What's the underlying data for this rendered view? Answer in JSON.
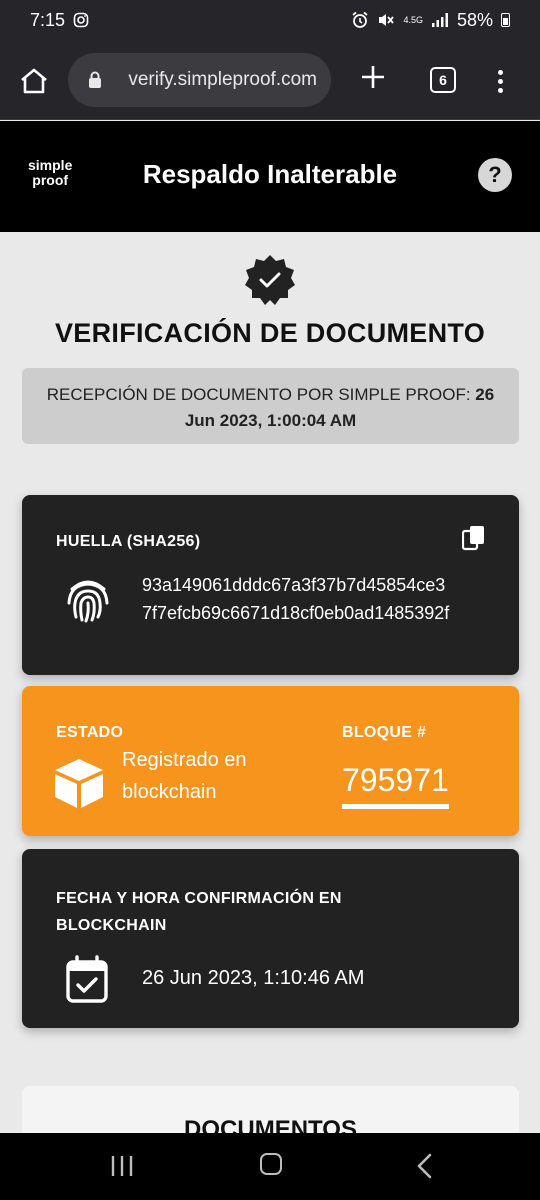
{
  "status_bar": {
    "time": "7:15",
    "network": "4.5G",
    "battery": "58%",
    "icons": [
      "instagram-icon",
      "alarm-icon",
      "mute-icon",
      "signal-icon",
      "battery-icon"
    ]
  },
  "browser": {
    "url": "verify.simpleproof.com",
    "tab_count": "6"
  },
  "header": {
    "logo_line1": "simple",
    "logo_line2": "proof",
    "title": "Respaldo Inalterable",
    "help": "?"
  },
  "verification": {
    "title": "VERIFICACIÓN DE DOCUMENTO",
    "reception_label": "RECEPCIÓN DE DOCUMENTO POR SIMPLE PROOF:",
    "reception_date": "26 Jun 2023, 1:00:04 AM"
  },
  "hash_card": {
    "label": "HUELLA (SHA256)",
    "hash_line1": "93a149061dddc67a3f37b7d45854ce3",
    "hash_line2": "7f7efcb69c6671d18cf0eb0ad1485392f"
  },
  "status_card": {
    "label": "ESTADO",
    "value_line1": "Registrado en",
    "value_line2": "blockchain",
    "block_label": "BLOQUE #",
    "block_number": "795971",
    "color": "#f7941d"
  },
  "date_card": {
    "label_line1": "FECHA Y HORA CONFIRMACIÓN EN",
    "label_line2": "BLOCKCHAIN",
    "value": "26 Jun 2023, 1:10:46 AM"
  },
  "documents_card": {
    "title": "DOCUMENTOS"
  }
}
